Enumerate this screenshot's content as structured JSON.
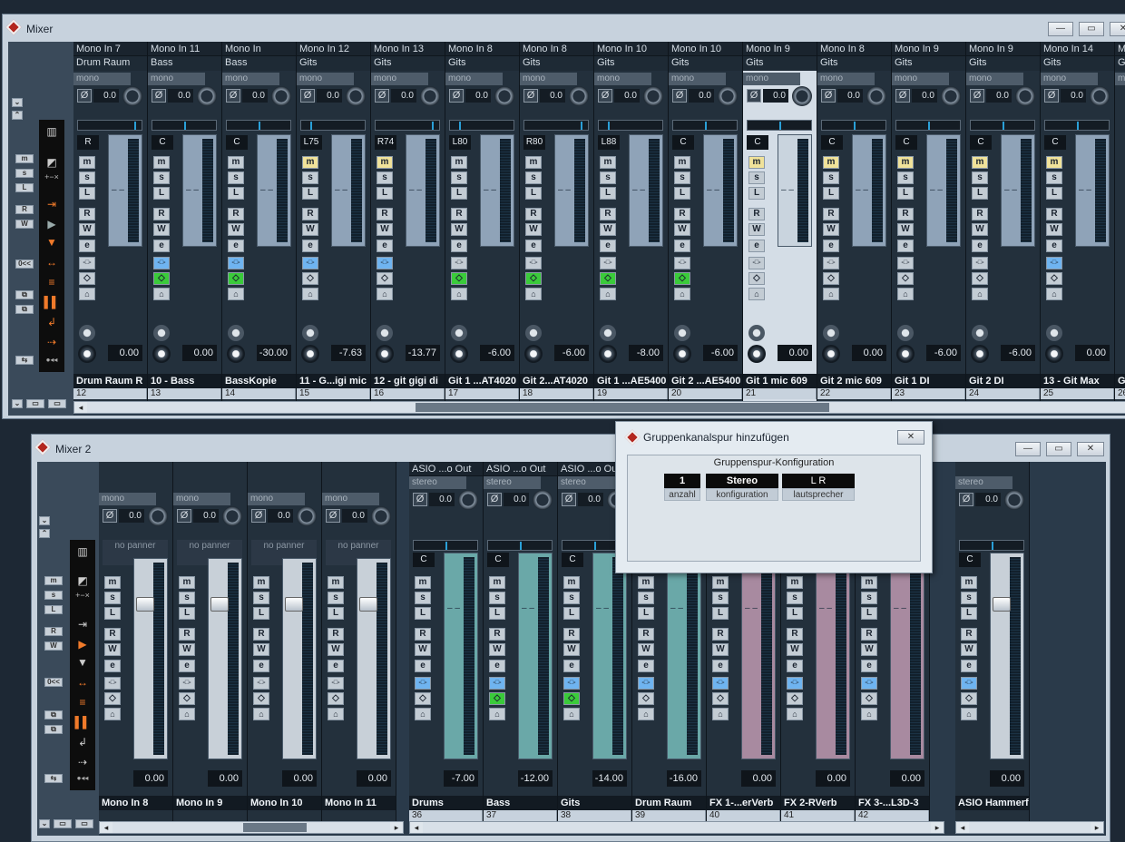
{
  "mixer1": {
    "title": "Mixer",
    "channels": [
      {
        "input": "Mono In 7",
        "sub": "Drum Raum",
        "routing": "mono",
        "gain": "0.0",
        "pan": "R",
        "m_on": false,
        "green": false,
        "blue": false,
        "vol": "0.00",
        "name": "Drum Raum R",
        "num": "12"
      },
      {
        "input": "Mono In 11",
        "sub": "Bass",
        "routing": "mono",
        "gain": "0.0",
        "pan": "C",
        "m_on": false,
        "green": true,
        "blue": true,
        "vol": "0.00",
        "name": "10 - Bass",
        "num": "13"
      },
      {
        "input": "Mono In",
        "sub": "Bass",
        "routing": "mono",
        "gain": "0.0",
        "pan": "C",
        "m_on": false,
        "green": true,
        "blue": true,
        "vol": "-30.00",
        "name": "BassKopie",
        "num": "14"
      },
      {
        "input": "Mono In 12",
        "sub": "Gits",
        "routing": "mono",
        "gain": "0.0",
        "pan": "L75",
        "m_on": true,
        "green": false,
        "blue": true,
        "vol": "-7.63",
        "name": "11 - G...igi mic",
        "num": "15"
      },
      {
        "input": "Mono In 13",
        "sub": "Gits",
        "routing": "mono",
        "gain": "0.0",
        "pan": "R74",
        "m_on": true,
        "green": false,
        "blue": true,
        "vol": "-13.77",
        "name": "12 - git gigi di",
        "num": "16"
      },
      {
        "input": "Mono In 8",
        "sub": "Gits",
        "routing": "mono",
        "gain": "0.0",
        "pan": "L80",
        "m_on": false,
        "green": true,
        "blue": false,
        "vol": "-6.00",
        "name": "Git 1 ...AT4020",
        "num": "17"
      },
      {
        "input": "Mono In 8",
        "sub": "Gits",
        "routing": "mono",
        "gain": "0.0",
        "pan": "R80",
        "m_on": false,
        "green": true,
        "blue": false,
        "vol": "-6.00",
        "name": "Git 2...AT4020",
        "num": "18"
      },
      {
        "input": "Mono In 10",
        "sub": "Gits",
        "routing": "mono",
        "gain": "0.0",
        "pan": "L88",
        "m_on": false,
        "green": true,
        "blue": false,
        "vol": "-8.00",
        "name": "Git 1 ...AE5400",
        "num": "19"
      },
      {
        "input": "Mono In 10",
        "sub": "Gits",
        "routing": "mono",
        "gain": "0.0",
        "pan": "C",
        "m_on": false,
        "green": true,
        "blue": false,
        "vol": "-6.00",
        "name": "Git 2 ...AE5400",
        "num": "20"
      },
      {
        "input": "Mono In 9",
        "sub": "Gits",
        "routing": "mono",
        "gain": "0.0",
        "pan": "C",
        "m_on": true,
        "green": false,
        "blue": false,
        "vol": "0.00",
        "name": "Git 1 mic 609",
        "num": "21",
        "selected": true
      },
      {
        "input": "Mono In 8",
        "sub": "Gits",
        "routing": "mono",
        "gain": "0.0",
        "pan": "C",
        "m_on": true,
        "green": false,
        "blue": false,
        "vol": "0.00",
        "name": "Git 2 mic 609",
        "num": "22"
      },
      {
        "input": "Mono In 9",
        "sub": "Gits",
        "routing": "mono",
        "gain": "0.0",
        "pan": "C",
        "m_on": true,
        "green": false,
        "blue": false,
        "vol": "-6.00",
        "name": "Git 1 DI",
        "num": "23"
      },
      {
        "input": "Mono In 9",
        "sub": "Gits",
        "routing": "mono",
        "gain": "0.0",
        "pan": "C",
        "m_on": true,
        "green": false,
        "blue": false,
        "vol": "-6.00",
        "name": "Git 2 DI",
        "num": "24"
      },
      {
        "input": "Mono In 14",
        "sub": "Gits",
        "routing": "mono",
        "gain": "0.0",
        "pan": "C",
        "m_on": true,
        "green": false,
        "blue": true,
        "vol": "0.00",
        "name": "13 - Git Max",
        "num": "25"
      }
    ],
    "partial": {
      "input": "Mo",
      "sub": "Gi",
      "routing": "mo",
      "name": "Gi",
      "num": "26"
    }
  },
  "mixer2": {
    "title": "Mixer 2",
    "no_panner": "no panner",
    "channels": [
      {
        "routing": "mono",
        "gain": "0.0",
        "vol": "0.00",
        "name": "Mono In 8"
      },
      {
        "routing": "mono",
        "gain": "0.0",
        "vol": "0.00",
        "name": "Mono In 9"
      },
      {
        "routing": "mono",
        "gain": "0.0",
        "vol": "0.00",
        "name": "Mono In 10"
      },
      {
        "routing": "mono",
        "gain": "0.0",
        "vol": "0.00",
        "name": "Mono In 11"
      }
    ],
    "groups": [
      {
        "input": "ASIO ...o Out",
        "routing": "stereo",
        "gain": "0.0",
        "pan": "C",
        "vol": "-7.00",
        "name": "Drums",
        "num": "36",
        "green": false
      },
      {
        "input": "ASIO ...o Out",
        "routing": "stereo",
        "gain": "0.0",
        "pan": "C",
        "vol": "-12.00",
        "name": "Bass",
        "num": "37",
        "green": true
      },
      {
        "input": "ASIO ...o Ou",
        "routing": "stereo",
        "gain": "0.0",
        "pan": "C",
        "vol": "-14.00",
        "name": "Gits",
        "num": "38",
        "green": true
      },
      {
        "input": "",
        "routing": "",
        "gain": "",
        "pan": "",
        "vol": "-16.00",
        "name": "Drum Raum",
        "num": "39",
        "green": false
      },
      {
        "input": "",
        "routing": "",
        "gain": "",
        "pan": "",
        "vol": "0.00",
        "name": "FX 1-...erVerb",
        "num": "40",
        "green": false
      },
      {
        "input": "",
        "routing": "",
        "gain": "",
        "pan": "",
        "vol": "0.00",
        "name": "FX 2-RVerb",
        "num": "41",
        "green": false
      },
      {
        "input": "",
        "routing": "",
        "gain": "",
        "pan": "",
        "vol": "0.00",
        "name": "FX 3-...L3D-3",
        "num": "42",
        "green": false
      }
    ],
    "master": {
      "routing": "stereo",
      "gain": "0.0",
      "pan": "C",
      "vol": "0.00",
      "name": "ASIO Hammerf"
    }
  },
  "dialog": {
    "title": "Gruppenkanalspur hinzufügen",
    "section": "Gruppenspur-Konfiguration",
    "count": "1",
    "count_label": "anzahl",
    "config": "Stereo",
    "config_label": "konfiguration",
    "speakers": "L R",
    "speakers_label": "lautsprecher"
  },
  "buttons": {
    "m": "m",
    "s": "s",
    "l": "L",
    "r": "R",
    "w": "W",
    "e": "e",
    "inf": "-∞",
    "minus_inf": "-∞"
  }
}
